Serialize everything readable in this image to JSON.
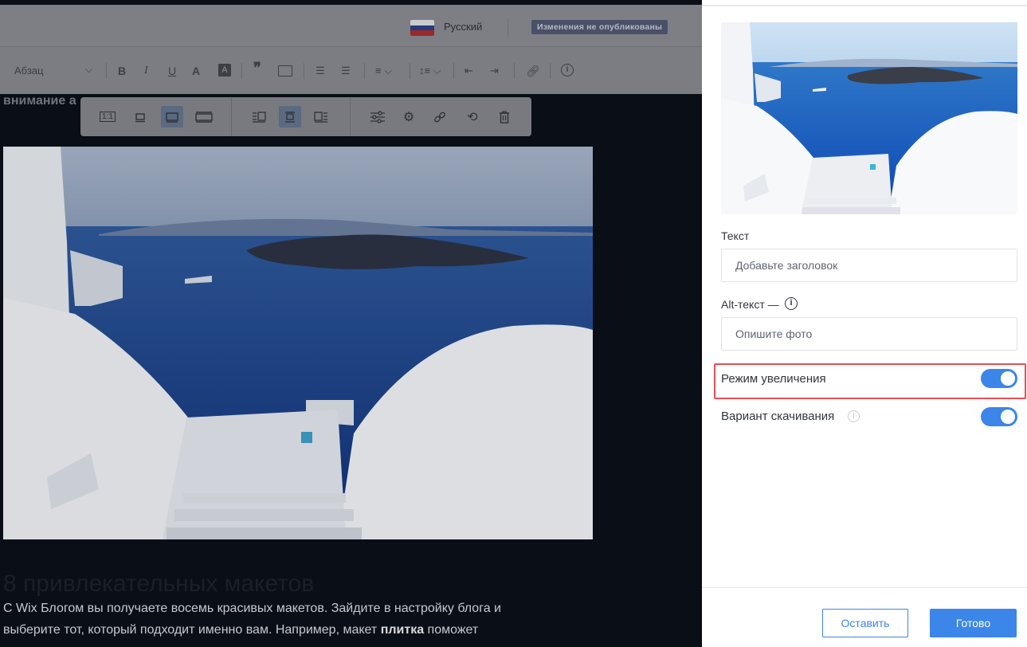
{
  "header": {
    "language": "Русский",
    "unpublished_badge": "Изменения не опубликованы",
    "flag_colors": [
      "#ffffff",
      "#0039a6",
      "#d52b1e"
    ]
  },
  "format_toolbar": {
    "paragraph_style": "Абзац",
    "icons": [
      "chevron-down-icon",
      "bold-icon",
      "italic-icon",
      "underline-icon",
      "text-color-icon",
      "highlight-icon",
      "quote-icon",
      "code-block-icon",
      "numbered-list-icon",
      "bulleted-list-icon",
      "align-icon",
      "line-spacing-icon",
      "decrease-indent-icon",
      "increase-indent-icon",
      "link-icon",
      "info-icon"
    ]
  },
  "article": {
    "top_text": "внимание а",
    "heading": "8 привлекательных макетов",
    "line1": "С Wix Блогом вы получаете восемь красивых макетов. Зайдите в настройку блога и",
    "line2_pre": "выберите тот, который подходит именно вам. Например, макет ",
    "line2_bold": "плитка",
    "line2_post": " поможет"
  },
  "image_toolbar": {
    "size_original_label": "1:1",
    "buttons": [
      "original-size-icon",
      "small-size-icon",
      "best-fit-icon",
      "full-width-icon",
      "align-left-icon",
      "align-center-icon",
      "align-right-icon",
      "adjust-icon",
      "settings-icon",
      "link-icon",
      "replace-icon",
      "delete-icon"
    ]
  },
  "panel": {
    "text_label": "Текст",
    "text_placeholder": "Добавьте заголовок",
    "alt_label": "Alt-текст —",
    "alt_placeholder": "Опишите фото",
    "zoom_label": "Режим увеличения",
    "zoom_enabled": true,
    "download_label": "Вариант скачивания",
    "download_enabled": true,
    "cancel_button": "Оставить",
    "done_button": "Готово",
    "accent_color": "#3b86e8",
    "highlight_color": "#e45055"
  }
}
